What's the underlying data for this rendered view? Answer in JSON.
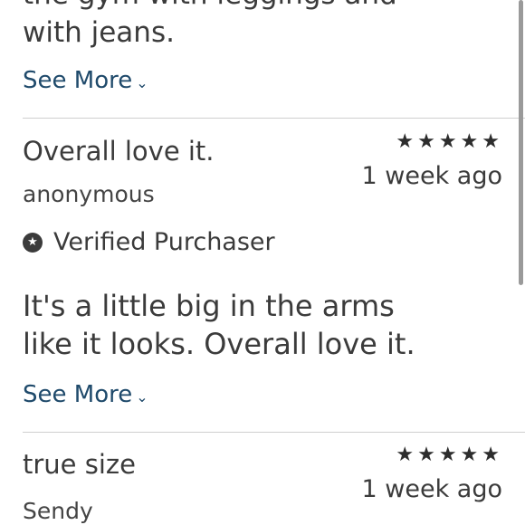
{
  "reviews": [
    {
      "body": "the gym with leggings and\nwith jeans.",
      "see_more_label": "See More"
    },
    {
      "title": "Overall love it.",
      "stars": "★★★★★",
      "date": "1 week ago",
      "author": "anonymous",
      "verified_label": "Verified Purchaser",
      "verified_icon": "★",
      "body": "It's a little big in the arms\nlike it looks. Overall love it.",
      "see_more_label": "See More"
    },
    {
      "title": "true size",
      "stars": "★★★★★",
      "date": "1 week ago",
      "author": "Sendy"
    }
  ],
  "chevron": "⌄"
}
